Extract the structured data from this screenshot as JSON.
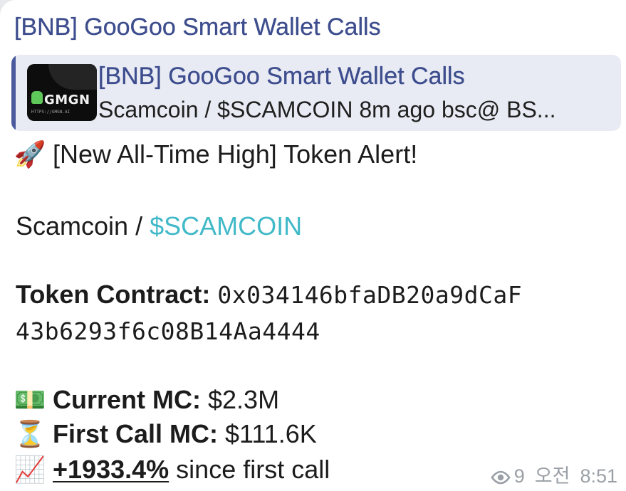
{
  "channel": {
    "title": "[BNB] GooGoo Smart Wallet Calls"
  },
  "reply_quote": {
    "title": "[BNB] GooGoo Smart Wallet Calls",
    "preview": "Scamcoin / $SCAMCOIN 8m ago bsc@ BS...",
    "thumbnail": {
      "logo_text": "GMGN",
      "url_text": "HTTPS://GMGN.AI"
    }
  },
  "message": {
    "headline_icon": "rocket-icon",
    "headline": "[New All-Time High] Token Alert!",
    "token_name": "Scamcoin",
    "separator": " / ",
    "token_ticker": "$SCAMCOIN",
    "contract_label": "Token Contract:",
    "contract_line1": "0x034146bfaDB20a9dCaF",
    "contract_line2": "43b6293f6c08B14Aa4444",
    "current_mc_icon": "money-icon",
    "current_mc_label": "Current MC:",
    "current_mc_value": "$2.3M",
    "first_call_icon": "hourglass-icon",
    "first_call_label": "First Call MC:",
    "first_call_value": "$111.6K",
    "change_icon": "chart-increasing-icon",
    "change_value": "+1933.4%",
    "change_suffix": "since first call"
  },
  "footer": {
    "views_icon": "eye-icon",
    "views": "9",
    "time_period": "오전",
    "time": "8:51"
  },
  "colors": {
    "title": "#3d4d8d",
    "quote_bg": "#e9ebf4",
    "quote_bar": "#4a5a9c",
    "ticker_link": "#41b9c8",
    "meta": "#9aa0a6"
  }
}
